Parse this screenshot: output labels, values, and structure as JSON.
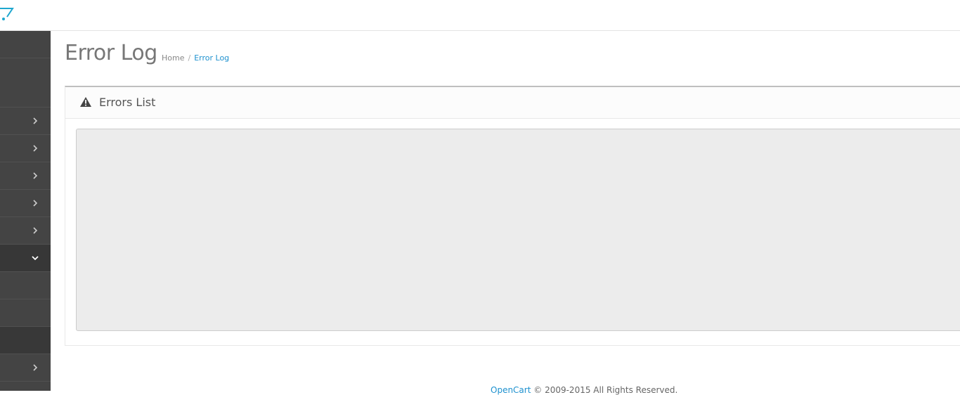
{
  "page": {
    "title": "Error Log",
    "breadcrumb": {
      "home": "Home",
      "separator": "/",
      "current": "Error Log"
    }
  },
  "panel": {
    "title": "Errors List",
    "icon": "warning-icon",
    "log_content": ""
  },
  "sidebar": {
    "items": [
      {
        "name": "sidebar-item-1",
        "icon": "",
        "state": "plain"
      },
      {
        "name": "sidebar-item-2",
        "icon": "",
        "state": "plain"
      },
      {
        "name": "sidebar-item-3",
        "icon": "chevron-right-icon",
        "state": "plain"
      },
      {
        "name": "sidebar-item-4",
        "icon": "chevron-right-icon",
        "state": "plain"
      },
      {
        "name": "sidebar-item-5",
        "icon": "chevron-right-icon",
        "state": "plain"
      },
      {
        "name": "sidebar-item-6",
        "icon": "chevron-right-icon",
        "state": "plain"
      },
      {
        "name": "sidebar-item-7",
        "icon": "chevron-right-icon",
        "state": "plain"
      },
      {
        "name": "sidebar-item-8",
        "icon": "chevron-down-icon",
        "state": "expanded"
      },
      {
        "name": "sidebar-subitem-1",
        "icon": "",
        "state": "plain"
      },
      {
        "name": "sidebar-subitem-2",
        "icon": "",
        "state": "plain"
      },
      {
        "name": "sidebar-subitem-3",
        "icon": "",
        "state": "active"
      },
      {
        "name": "sidebar-item-9",
        "icon": "chevron-right-icon",
        "state": "plain"
      }
    ]
  },
  "footer": {
    "link_text": "OpenCart",
    "copyright": "© 2009-2015 All Rights Reserved."
  },
  "colors": {
    "accent": "#1e91cf",
    "sidebar_bg": "#444444",
    "sidebar_active": "#383838",
    "log_area_bg": "#ececec"
  }
}
